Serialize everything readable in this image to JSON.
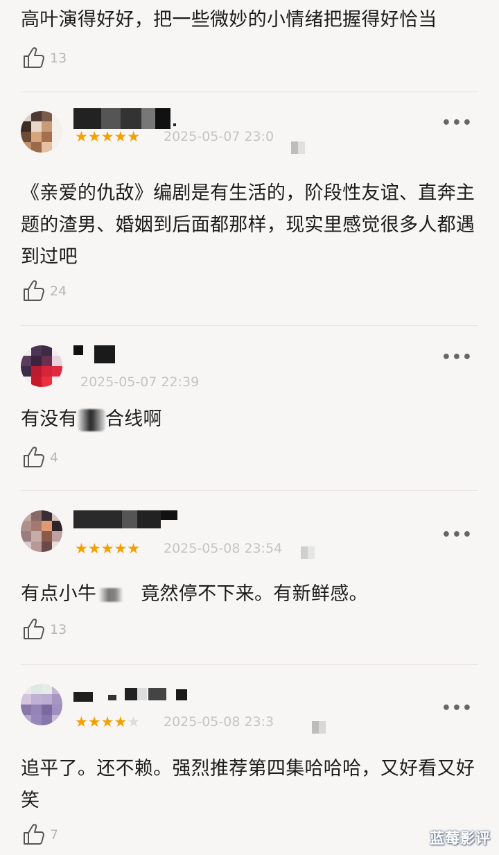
{
  "comments": [
    {
      "text": "高叶演得好好，把一些微妙的小情绪把握得好恰当",
      "likes": "13"
    },
    {
      "stars": 5,
      "date": "2025-05-07 23:0",
      "text": "《亲爱的仇敌》编剧是有生活的，阶段性友谊、直奔主题的渣男、婚姻到后面都那样，现实里感觉很多人都遇到过吧",
      "likes": "24"
    },
    {
      "date": "2025-05-07 22:39",
      "text_before": "有没有",
      "text_after": "合线啊",
      "likes": "4"
    },
    {
      "stars": 5,
      "date": "2025-05-08 23:54",
      "text_before": "有点小牛",
      "text_after": "竟然停不下来。有新鲜感。",
      "likes": "13"
    },
    {
      "stars": 4,
      "date": "2025-05-08 23:3",
      "text": "追平了。还不赖。强烈推荐第四集哈哈哈，又好看又好笑",
      "likes": "7"
    }
  ],
  "icons": {
    "like": "thumbs-up-icon",
    "more": "more-dots-icon",
    "star": "star-icon"
  },
  "more_glyph": "•••",
  "star_glyph": "★",
  "watermark": "蓝莓影评",
  "colors": {
    "background": "#f8f6f5",
    "star": "#f5a000",
    "star_off": "#dcdcdc",
    "meta": "#c4c4c4"
  }
}
